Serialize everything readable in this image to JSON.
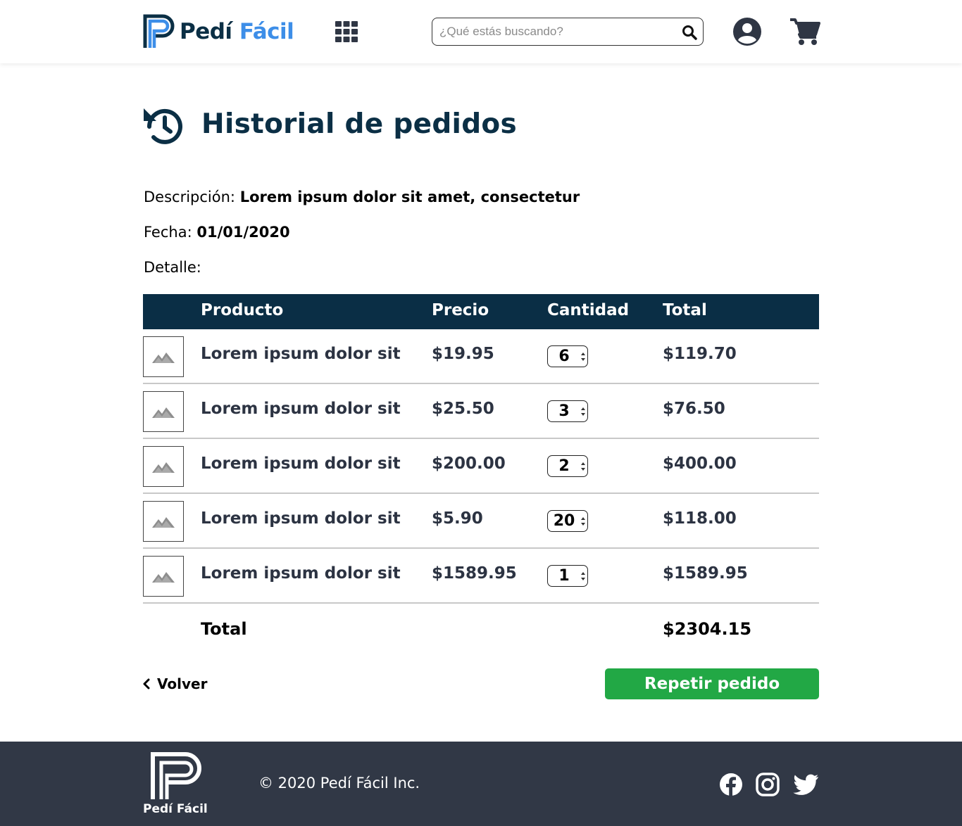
{
  "header": {
    "brand_part1": "Pedí",
    "brand_part2": "Fácil",
    "search_placeholder": "¿Qué estás buscando?"
  },
  "page": {
    "title": "Historial de pedidos",
    "description_label": "Descripción:",
    "description_value": "Lorem ipsum dolor sit amet, consectetur",
    "date_label": "Fecha:",
    "date_value": "01/01/2020",
    "detail_label": "Detalle:"
  },
  "table": {
    "headers": {
      "product": "Producto",
      "price": "Precio",
      "quantity": "Cantidad",
      "total": "Total"
    },
    "rows": [
      {
        "product": "Lorem ipsum dolor sit",
        "price": "$19.95",
        "quantity": "6",
        "total": "$119.70"
      },
      {
        "product": "Lorem ipsum dolor sit",
        "price": "$25.50",
        "quantity": "3",
        "total": "$76.50"
      },
      {
        "product": "Lorem ipsum dolor sit",
        "price": "$200.00",
        "quantity": "2",
        "total": "$400.00"
      },
      {
        "product": "Lorem ipsum dolor sit",
        "price": "$5.90",
        "quantity": "20",
        "total": "$118.00"
      },
      {
        "product": "Lorem ipsum dolor sit",
        "price": "$1589.95",
        "quantity": "1",
        "total": "$1589.95"
      }
    ],
    "total_label": "Total",
    "total_value": "$2304.15"
  },
  "actions": {
    "back_label": "Volver",
    "repeat_label": "Repetir pedido"
  },
  "footer": {
    "brand": "Pedí Fácil",
    "copyright": "© 2020 Pedí Fácil Inc.",
    "social_icons": [
      "facebook-icon",
      "instagram-icon",
      "twitter-icon"
    ]
  },
  "colors": {
    "navy": "#0b2f45",
    "brand_blue": "#3d8ee8",
    "green": "#22a845",
    "footer_bg": "#313846"
  }
}
